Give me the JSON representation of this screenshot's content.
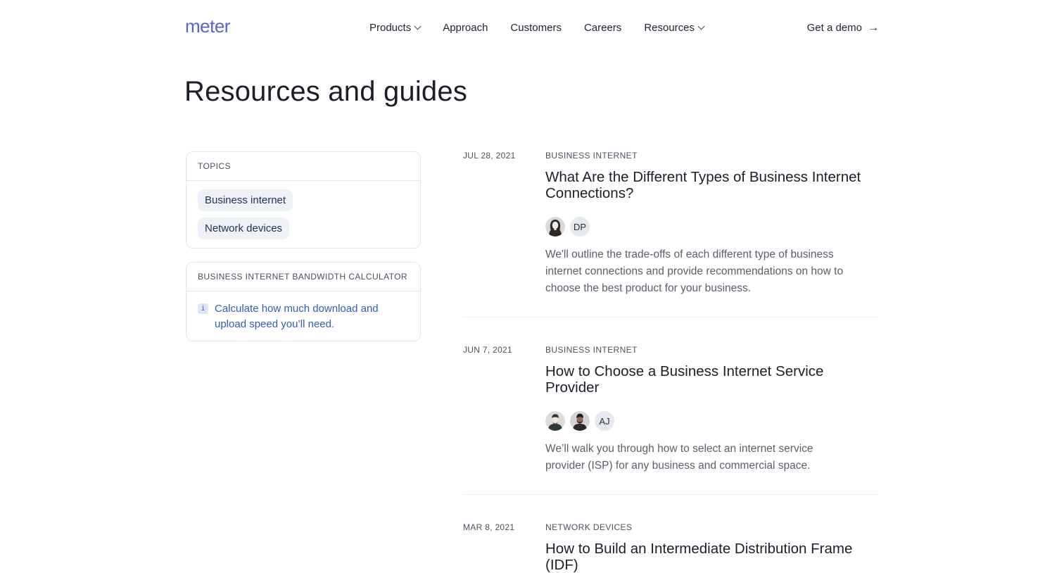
{
  "brand": {
    "logo_text": "meter",
    "accent": "#5865c6"
  },
  "nav": {
    "items": [
      {
        "label": "Products",
        "has_dropdown": true
      },
      {
        "label": "Approach",
        "has_dropdown": false
      },
      {
        "label": "Customers",
        "has_dropdown": false
      },
      {
        "label": "Careers",
        "has_dropdown": false
      },
      {
        "label": "Resources",
        "has_dropdown": true
      }
    ],
    "cta_label": "Get a demo",
    "cta_icon": "arrow-right-icon"
  },
  "page": {
    "title": "Resources and guides"
  },
  "sidebar": {
    "topics": {
      "heading": "TOPICS",
      "chips": [
        "Business internet",
        "Network devices"
      ]
    },
    "calculator": {
      "heading": "BUSINESS INTERNET BANDWIDTH CALCULATOR",
      "icon_text": "i",
      "link_line1": "Calculate how much download and",
      "link_line2": "upload speed you’ll need."
    }
  },
  "articles": [
    {
      "date": "JUL 28, 2021",
      "category": "BUSINESS INTERNET",
      "title_line1": "What Are the Different Types of Business Internet",
      "title_line2": "Connections?",
      "authors": [
        {
          "type": "photo",
          "icon": "avatar-woman-icon"
        },
        {
          "type": "initials",
          "text": "DP"
        }
      ],
      "desc_line1": "We'll outline the trade-offs of each different type of business",
      "desc_line2": "internet connections and provide recommendations on how to",
      "desc_line3": "choose the best product for your business."
    },
    {
      "date": "JUN 7, 2021",
      "category": "BUSINESS INTERNET",
      "title_line1": "How to Choose a Business Internet Service",
      "title_line2": "Provider",
      "authors": [
        {
          "type": "photo",
          "icon": "avatar-man-icon"
        },
        {
          "type": "photo",
          "icon": "avatar-man-bearded-icon"
        },
        {
          "type": "initials",
          "text": "AJ"
        }
      ],
      "desc_line1": "We’ll walk you through how to select an internet service",
      "desc_line2": "provider (ISP) for any business and commercial space."
    },
    {
      "date": "MAR 8, 2021",
      "category": "NETWORK DEVICES",
      "title_line1": "How to Build an Intermediate Distribution Frame",
      "title_line2": "(IDF)"
    }
  ]
}
